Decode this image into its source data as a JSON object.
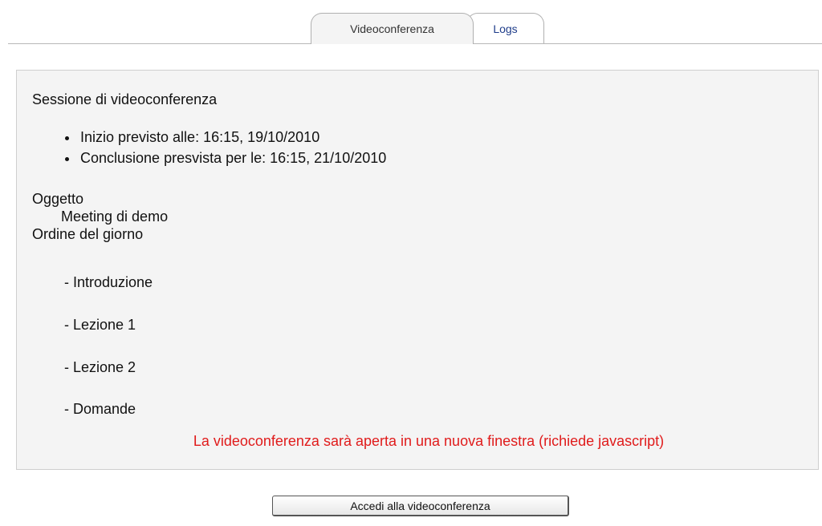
{
  "tabs": [
    {
      "label": "Videoconferenza",
      "active": true
    },
    {
      "label": "Logs",
      "active": false
    }
  ],
  "session": {
    "title": "Sessione di videoconferenza",
    "start": "Inizio previsto alle: 16:15, 19/10/2010",
    "end": "Conclusione presvista per le: 16:15, 21/10/2010"
  },
  "object": {
    "label": "Oggetto",
    "value": "Meeting di demo"
  },
  "agenda": {
    "label": "Ordine del giorno",
    "items": [
      "- Introduzione",
      "- Lezione 1",
      "- Lezione 2",
      "- Domande"
    ]
  },
  "note": "La videoconferenza sarà aperta in una nuova finestra (richiede javascript)",
  "button": {
    "label": "Accedi alla videoconferenza"
  },
  "colors": {
    "note": "#e01b1b",
    "tab_link": "#1f3d8a",
    "panel_bg": "#f4f4f4"
  }
}
